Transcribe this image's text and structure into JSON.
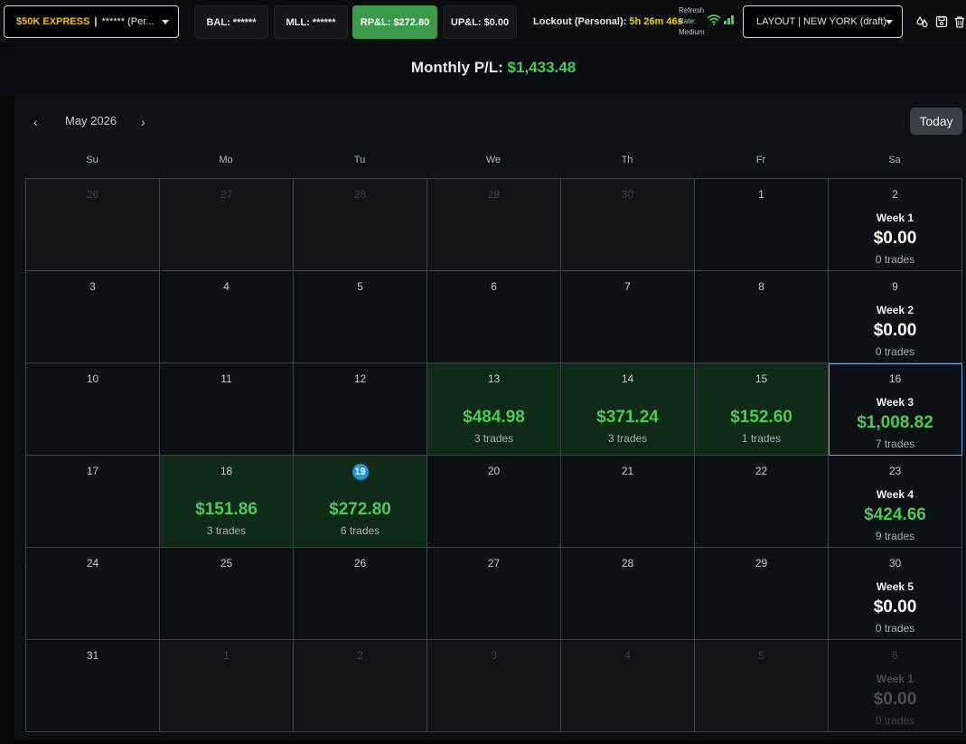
{
  "topbar": {
    "account_tag": "$50K EXPRESS",
    "account_sep": "|",
    "account_name": "****** (Per...",
    "bal": "BAL: ******",
    "mll": "MLL: ******",
    "rpl": "RP&L: $272.80",
    "upl": "UP&L: $0.00",
    "lockout_label": "Lockout (Personal):",
    "lockout_value": "5h 26m 46s",
    "refresh_line1": "Refresh",
    "refresh_line2": "Rate:",
    "refresh_line3": "Medium",
    "layout": "LAYOUT | NEW YORK (draft)",
    "colors": {
      "accent_yellow": "#f1c21b",
      "rpl_green": "#3d9a4d"
    }
  },
  "summary": {
    "label": "Monthly P/L:",
    "amount": "$1,433.48"
  },
  "calendar": {
    "month_label": "May 2026",
    "today_label": "Today",
    "prev_icon": "chevron-left-icon",
    "next_icon": "chevron-right-icon",
    "weekdays": [
      "Su",
      "Mo",
      "Tu",
      "We",
      "Th",
      "Fr",
      "Sa"
    ],
    "rows": [
      {
        "days": [
          {
            "n": "26",
            "other": true
          },
          {
            "n": "27",
            "other": true
          },
          {
            "n": "28",
            "other": true
          },
          {
            "n": "29",
            "other": true
          },
          {
            "n": "30",
            "other": true
          },
          {
            "n": "1"
          }
        ],
        "week": {
          "n": "2",
          "label": "Week 1",
          "pl": "$0.00",
          "trades": "0 trades"
        }
      },
      {
        "days": [
          {
            "n": "3"
          },
          {
            "n": "4"
          },
          {
            "n": "5"
          },
          {
            "n": "6"
          },
          {
            "n": "7"
          },
          {
            "n": "8"
          }
        ],
        "week": {
          "n": "9",
          "label": "Week 2",
          "pl": "$0.00",
          "trades": "0 trades"
        }
      },
      {
        "days": [
          {
            "n": "10"
          },
          {
            "n": "11"
          },
          {
            "n": "12"
          },
          {
            "n": "13",
            "pl": "$484.98",
            "trades": "3 trades"
          },
          {
            "n": "14",
            "pl": "$371.24",
            "trades": "3 trades"
          },
          {
            "n": "15",
            "pl": "$152.60",
            "trades": "1 trades"
          }
        ],
        "week": {
          "n": "16",
          "label": "Week 3",
          "pl": "$1,008.82",
          "trades": "7 trades",
          "pos": true,
          "selected": true
        }
      },
      {
        "days": [
          {
            "n": "17"
          },
          {
            "n": "18",
            "pl": "$151.86",
            "trades": "3 trades"
          },
          {
            "n": "19",
            "pl": "$272.80",
            "trades": "6 trades",
            "today": true
          },
          {
            "n": "20"
          },
          {
            "n": "21"
          },
          {
            "n": "22"
          }
        ],
        "week": {
          "n": "23",
          "label": "Week 4",
          "pl": "$424.66",
          "trades": "9 trades",
          "pos": true
        }
      },
      {
        "days": [
          {
            "n": "24"
          },
          {
            "n": "25"
          },
          {
            "n": "26"
          },
          {
            "n": "27"
          },
          {
            "n": "28"
          },
          {
            "n": "29"
          }
        ],
        "week": {
          "n": "30",
          "label": "Week 5",
          "pl": "$0.00",
          "trades": "0 trades"
        }
      },
      {
        "days": [
          {
            "n": "31"
          },
          {
            "n": "1",
            "other": true
          },
          {
            "n": "2",
            "other": true
          },
          {
            "n": "3",
            "other": true
          },
          {
            "n": "4",
            "other": true
          },
          {
            "n": "5",
            "other": true
          }
        ],
        "week": {
          "n": "6",
          "label": "Week 1",
          "pl": "$0.00",
          "trades": "0 trades",
          "dim": true
        }
      }
    ]
  }
}
